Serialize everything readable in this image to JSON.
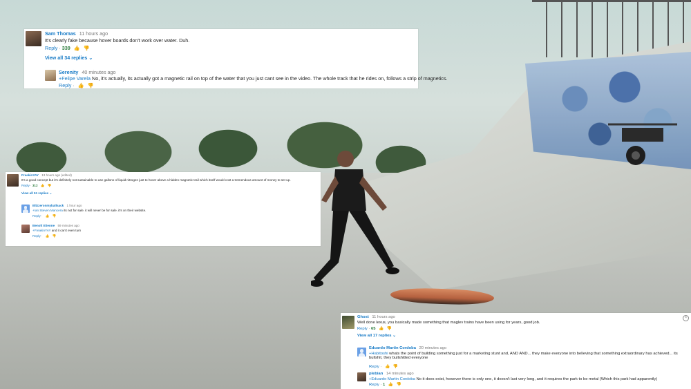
{
  "comments_top": {
    "main": {
      "author": "Sam Thomas",
      "time": "11 hours ago",
      "text": "It's clearly fake because hover boards don't work over water. Duh.",
      "reply_label": "Reply",
      "likes": "339"
    },
    "view_all": "View all 34 replies",
    "reply": {
      "author": "Serenity",
      "time": "40 minutes ago",
      "mention": "+Felipe Varela",
      "text": " No, it's actually, its actually got a magnetic rail on top of the water that you just cant see in the video. The whole track that he rides on, follows a strip of magnetics.",
      "reply_label": "Reply"
    }
  },
  "comments_left": {
    "main": {
      "author": "FreakinYAY",
      "time": "13 hours ago (edited)",
      "text": "It's a good concept but it's definitely not sustainable to use gallons of liquid nitrogen just to hover above a hidden magnetic trail which itself would cost a tremendous amount of money to set up.",
      "reply_label": "Reply",
      "likes": "312"
    },
    "view_all": "View all 51 replies",
    "replies": [
      {
        "author": "Blizzeronmyballsack",
        "time": "1 hour ago",
        "mention": "+Ian Steven Mancera",
        "text": " its not for sale. it will never be for sale. it's on their website.",
        "reply_label": "Reply"
      },
      {
        "author": "Benoît Etienne",
        "time": "59 minutes ago",
        "mention": "+FreakinYAY",
        "text": " and it can't even turn",
        "reply_label": "Reply"
      }
    ]
  },
  "comments_bottom": {
    "main": {
      "author": "Ghost",
      "time": "11 hours ago",
      "text": "Well done lexus, you basically made something that maglev trains have been using for years, good job.",
      "reply_label": "Reply",
      "likes": "65"
    },
    "view_all": "View all 17 replies",
    "replies": [
      {
        "author": "Eduardo Martin Cordoba",
        "time": "20 minutes ago",
        "mention": "+Habitoshi",
        "text": " whats the point of building something just for a marketing stunt and, AND AND... they make everyone into believing that something extraordinary has achieved... its bullshit, they bullshitted everyone",
        "reply_label": "Reply"
      },
      {
        "author": "plebian",
        "time": "14 minutes ago",
        "mention": "+Eduardo Martin Cordoba",
        "text": " No it does exist, however there is only one, it doesn't last very long, and it requires the park to be metal (Which this park had apparently)",
        "reply_label": "Reply",
        "likes": "1"
      }
    ]
  },
  "icons": {
    "thumb_up": "thumb-up-icon",
    "thumb_down": "thumb-down-icon",
    "chevron": "chevron-down-icon",
    "close": "close-icon"
  }
}
